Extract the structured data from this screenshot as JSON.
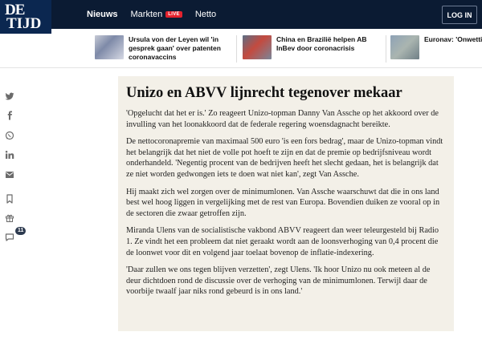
{
  "logo": {
    "line1": "DE",
    "line2": "TIJD"
  },
  "nav": {
    "items": [
      {
        "label": "Nieuws"
      },
      {
        "label": "Markten"
      },
      {
        "label": "Netto"
      }
    ],
    "live_badge": "LIVE",
    "login_label": "LOG IN"
  },
  "headlines": [
    {
      "text": "Ursula von der Leyen wil 'in gesprek gaan' over patenten coronavaccins"
    },
    {
      "text": "China en Brazilië helpen AB InBev door coronacrisis"
    },
    {
      "text": "Euronav: 'Onwetti verhindert sloop c"
    }
  ],
  "share": {
    "icons": [
      "twitter-icon",
      "facebook-icon",
      "whatsapp-icon",
      "linkedin-icon",
      "mail-icon",
      "bookmark-icon",
      "gift-icon",
      "comment-icon"
    ],
    "comment_count": "11"
  },
  "article": {
    "title": "Unizo en ABVV lijnrecht tegenover mekaar",
    "paragraphs": [
      "'Opgelucht dat het er is.' Zo reageert Unizo-topman Danny Van Assche op het akkoord over de invulling van het loonakkoord dat de federale regering woensdagnacht bereikte.",
      "De nettocoronapremie van maximaal 500 euro 'is een fors bedrag', maar de Unizo-topman vindt het belangrijk dat het niet de volle pot hoeft te zijn en dat de premie op bedrijfsniveau wordt onderhandeld. 'Negentig procent van de bedrijven heeft het slecht gedaan, het is belangrijk dat ze niet worden gedwongen iets te doen wat niet kan', zegt Van Assche.",
      "Hij maakt zich wel zorgen over de minimumlonen. Van Assche waarschuwt dat die in ons land best wel hoog liggen in vergelijking met de rest van Europa. Bovendien duiken ze vooral op in de sectoren die zwaar getroffen zijn.",
      "Miranda Ulens van de socialistische vakbond ABVV reageert dan weer teleurgesteld bij Radio 1. Ze vindt het een probleem dat niet geraakt wordt aan de loonsverhoging van 0,4 procent die de loonwet voor dit en volgend jaar toelaat bovenop de inflatie-indexering.",
      "'Daar zullen we ons tegen blijven verzetten', zegt Ulens. 'Ik hoor Unizo nu ook meteen al de deur dichtdoen rond de discussie over de verhoging van de minimumlonen. Terwijl daar de voorbije twaalf jaar niks rond gebeurd is in ons land.'"
    ]
  },
  "colors": {
    "nav_bg": "#0b1b33",
    "logo_bg": "#0b2750",
    "live_red": "#e4222d",
    "article_bg": "#f3f0e8",
    "icon_gray": "#6b6b6b"
  }
}
